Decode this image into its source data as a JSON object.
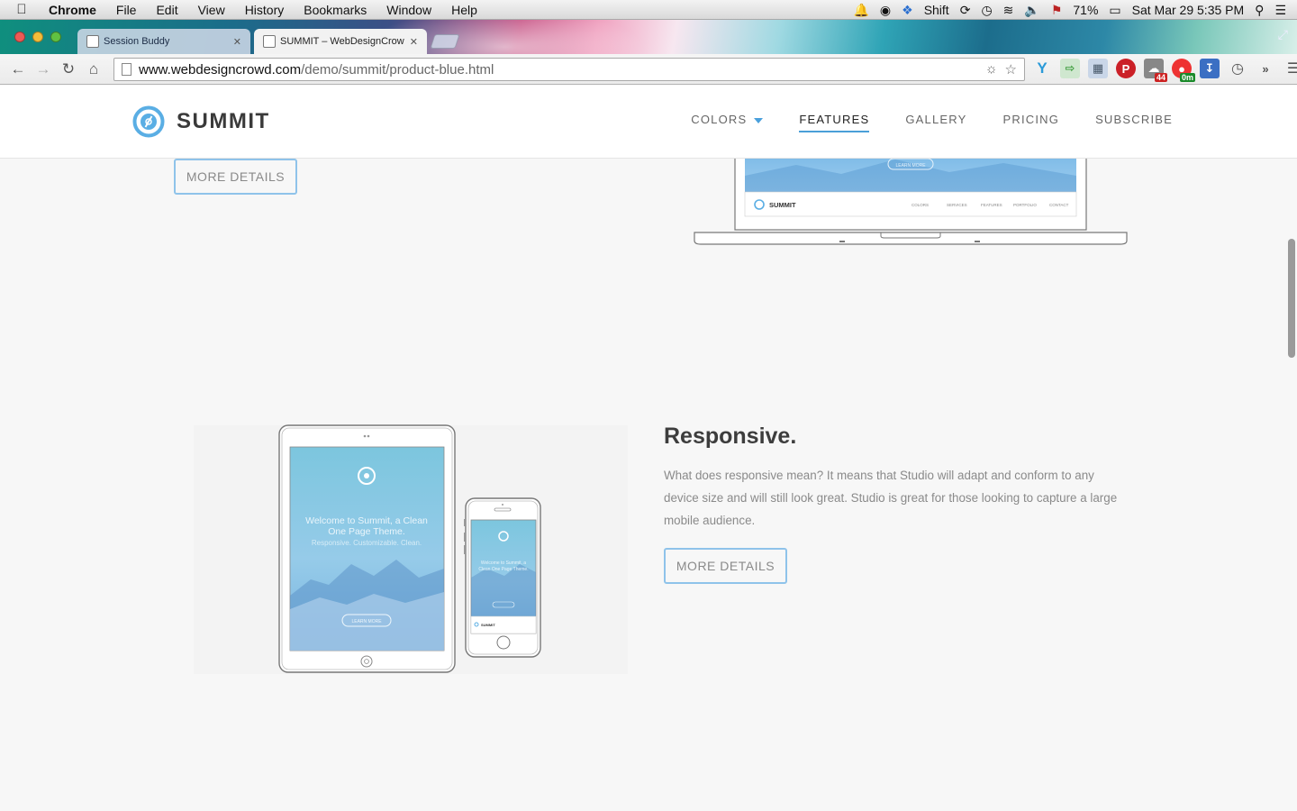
{
  "menubar": {
    "app": "Chrome",
    "items": [
      "File",
      "Edit",
      "View",
      "History",
      "Bookmarks",
      "Window",
      "Help"
    ],
    "status": {
      "shift": "Shift",
      "battery": "71%",
      "datetime": "Sat Mar 29  5:35 PM"
    }
  },
  "tabs": [
    {
      "title": "Session Buddy",
      "active": false
    },
    {
      "title": "SUMMIT – WebDesignCrow",
      "active": true
    }
  ],
  "omnibox": {
    "host": "www.webdesigncrowd.com",
    "path": "/demo/summit/product-blue.html"
  },
  "extensions": {
    "badge_44": "44",
    "badge_0m": "0m"
  },
  "site": {
    "logo": "SUMMIT",
    "nav": [
      {
        "label": "COLORS",
        "dropdown": true
      },
      {
        "label": "FEATURES",
        "active": true
      },
      {
        "label": "GALLERY"
      },
      {
        "label": "PRICING"
      },
      {
        "label": "SUBSCRIBE"
      }
    ],
    "more_details_top": "MORE DETAILS",
    "responsive": {
      "title": "Responsive.",
      "body": "What does responsive mean? It means that Studio will adapt and conform to any device size and will still look great. Studio is great for those looking to capture a large mobile audience.",
      "button": "MORE DETAILS"
    },
    "mock_laptop": {
      "learn_more": "LEARN MORE",
      "brand": "SUMMIT",
      "nav": [
        "COLORS",
        "SERVICES",
        "FEATURES",
        "PORTFOLIO",
        "CONTACT"
      ]
    },
    "mock_tablet": {
      "headline_1": "Welcome to Summit, a Clean",
      "headline_2": "One Page Theme.",
      "tagline": "Responsive. Customizable. Clean.",
      "learn_more": "LEARN MORE"
    },
    "mock_phone": {
      "headline_1": "Welcome to Summit, a",
      "headline_2": "Clean One Page Theme.",
      "brand": "SUMMIT"
    }
  },
  "colors": {
    "accent": "#4a9fd8",
    "button_border": "#8fc3ea",
    "heading": "#3d3d3d",
    "body_text": "#8a8a8a"
  }
}
